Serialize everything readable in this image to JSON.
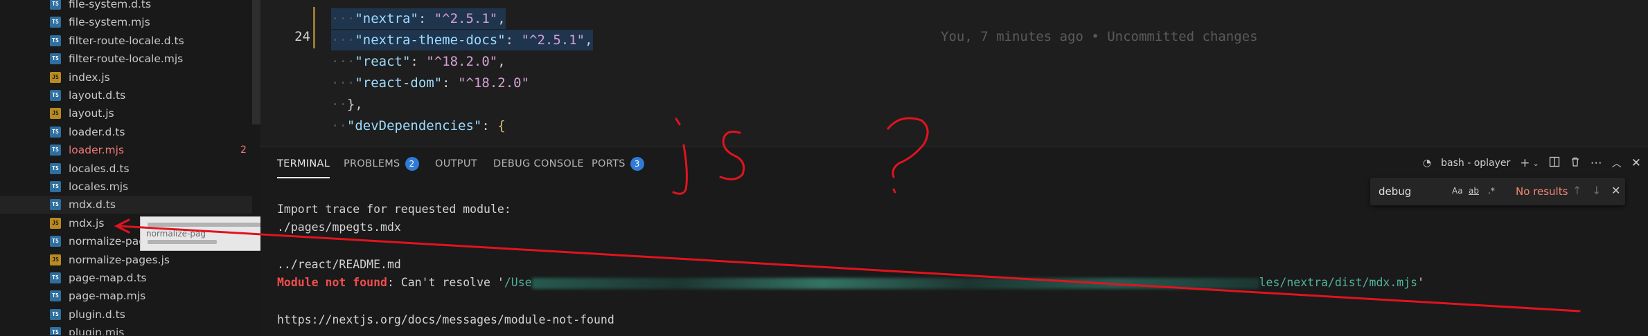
{
  "explorer": {
    "files": [
      {
        "name": "file-system.d.ts",
        "type": "ts"
      },
      {
        "name": "file-system.mjs",
        "type": "ts"
      },
      {
        "name": "filter-route-locale.d.ts",
        "type": "ts"
      },
      {
        "name": "filter-route-locale.mjs",
        "type": "ts"
      },
      {
        "name": "index.js",
        "type": "js"
      },
      {
        "name": "layout.d.ts",
        "type": "ts"
      },
      {
        "name": "layout.js",
        "type": "js"
      },
      {
        "name": "loader.d.ts",
        "type": "ts"
      },
      {
        "name": "loader.mjs",
        "type": "ts",
        "error": true,
        "badge": "2"
      },
      {
        "name": "locales.d.ts",
        "type": "ts"
      },
      {
        "name": "locales.mjs",
        "type": "ts"
      },
      {
        "name": "mdx.d.ts",
        "type": "ts",
        "selected": true
      },
      {
        "name": "mdx.js",
        "type": "js"
      },
      {
        "name": "normalize-pages.d.ts",
        "type": "ts"
      },
      {
        "name": "normalize-pages.js",
        "type": "js"
      },
      {
        "name": "page-map.d.ts",
        "type": "ts"
      },
      {
        "name": "page-map.mjs",
        "type": "ts"
      },
      {
        "name": "plugin.d.ts",
        "type": "ts"
      },
      {
        "name": "plugin.mjs",
        "type": "ts"
      }
    ],
    "drag_ghost_text": "normalize-pag"
  },
  "editor": {
    "current_line_number": "24",
    "lines": [
      {
        "key": "\"nextra\"",
        "value": "\"^2.5.1\"",
        "trail": ",",
        "indent": 3,
        "highlight": true
      },
      {
        "key": "\"nextra-theme-docs\"",
        "value": "\"^2.5.1\"",
        "trail": ",",
        "indent": 3,
        "highlight": true
      },
      {
        "key": "\"react\"",
        "value": "\"^18.2.0\"",
        "trail": ",",
        "indent": 3
      },
      {
        "key": "\"react-dom\"",
        "value": "\"^18.2.0\"",
        "trail": "",
        "indent": 3
      },
      {
        "raw": "},",
        "indent": 2
      },
      {
        "key": "\"devDependencies\"",
        "value": "{",
        "trail": "",
        "indent": 2,
        "brace": true
      }
    ],
    "inline_blame": "You, 7 minutes ago • Uncommitted changes"
  },
  "panel": {
    "tabs": [
      {
        "label": "TERMINAL",
        "active": true
      },
      {
        "label": "PROBLEMS",
        "badge": "2"
      },
      {
        "label": "OUTPUT"
      },
      {
        "label": "DEBUG CONSOLE"
      },
      {
        "label": "PORTS",
        "badge": "3"
      }
    ],
    "terminal_label": "bash - oplayer",
    "find": {
      "value": "debug",
      "opt_case": "Aa",
      "opt_word": "ab",
      "opt_regex": ".*",
      "result": "No results"
    }
  },
  "terminal": {
    "line1": "Import trace for requested module:",
    "line2": "./pages/mpegts.mdx",
    "line3": "../react/README.md",
    "err_label": "Module not found",
    "err_msg": ": Can't resolve '",
    "err_path_start": "/Use",
    "err_path_end": "les/nextra/dist/mdx.mjs",
    "err_quote": "'",
    "line5": "https://nextjs.org/docs/messages/module-not-found"
  },
  "annotation": {
    "text": "js?",
    "color": "#e0141e"
  }
}
